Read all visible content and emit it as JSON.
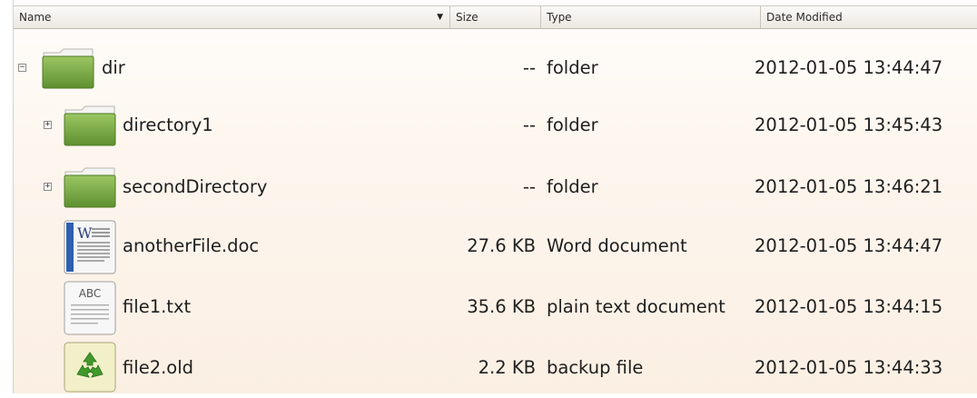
{
  "columns": {
    "name": "Name",
    "size": "Size",
    "type": "Type",
    "date": "Date Modified"
  },
  "sort_indicator": "▼",
  "rows": [
    {
      "name": "dir",
      "size": "--",
      "type": "folder",
      "date": "2012-01-05 13:44:47",
      "icon": "folder-icon",
      "expander": "−",
      "level": 0
    },
    {
      "name": "directory1",
      "size": "--",
      "type": "folder",
      "date": "2012-01-05 13:45:43",
      "icon": "folder-icon",
      "expander": "+",
      "level": 1
    },
    {
      "name": "secondDirectory",
      "size": "--",
      "type": "folder",
      "date": "2012-01-05 13:46:21",
      "icon": "folder-icon",
      "expander": "+",
      "level": 1
    },
    {
      "name": "anotherFile.doc",
      "size": "27.6 KB",
      "type": "Word document",
      "date": "2012-01-05 13:44:47",
      "icon": "word-document-icon",
      "level": 1
    },
    {
      "name": "file1.txt",
      "size": "35.6 KB",
      "type": "plain text document",
      "date": "2012-01-05 13:44:15",
      "icon": "text-document-icon",
      "level": 1
    },
    {
      "name": "file2.old",
      "size": "2.2 KB",
      "type": "backup file",
      "date": "2012-01-05 13:44:33",
      "icon": "backup-file-icon",
      "level": 1
    }
  ],
  "icon_labels": {
    "word": "W",
    "text": "ABC"
  },
  "colors": {
    "folder_green": "#7aab44",
    "folder_dark": "#5b8a2c",
    "header_bg": "#ece8e2",
    "view_bg": "#fdf6ee"
  }
}
